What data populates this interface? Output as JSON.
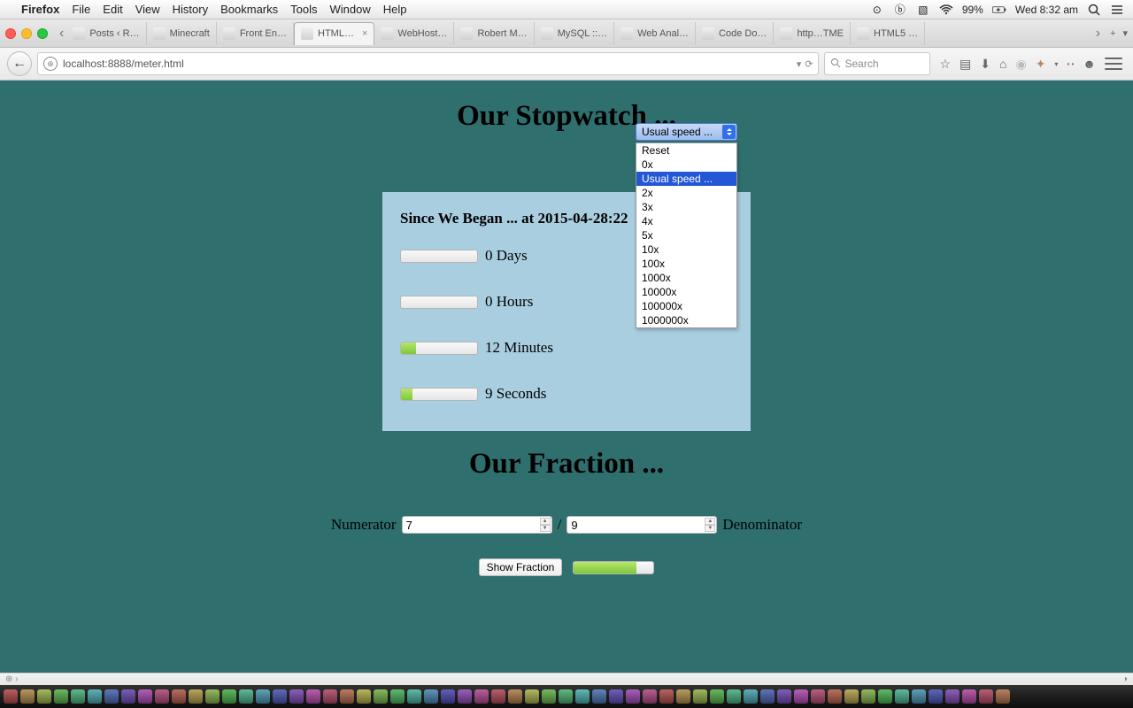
{
  "menubar": {
    "app": "Firefox",
    "items": [
      "File",
      "Edit",
      "View",
      "History",
      "Bookmarks",
      "Tools",
      "Window",
      "Help"
    ],
    "battery": "99%",
    "clock": "Wed 8:32 am"
  },
  "tabstrip": {
    "tabs": [
      "Posts ‹ R…",
      "Minecraft",
      "Front En…",
      "HTML…",
      "WebHost…",
      "Robert M…",
      "MySQL ::…",
      "Web Anal…",
      "Code Do…",
      "http…TME",
      "HTML5 …"
    ],
    "active_index": 3
  },
  "urlbar": {
    "address": "localhost:8888/meter.html",
    "search_placeholder": "Search"
  },
  "stopwatch": {
    "heading": "Our Stopwatch ...",
    "select_label": "Usual speed ...",
    "options": [
      "Reset",
      "0x",
      "Usual speed ...",
      "2x",
      "3x",
      "4x",
      "5x",
      "10x",
      "100x",
      "1000x",
      "10000x",
      "100000x",
      "1000000x"
    ],
    "selected_index": 2,
    "card_title": "Since We Began ... at 2015-04-28:22",
    "rows": [
      {
        "value": "0 Days",
        "pct": 0
      },
      {
        "value": "0 Hours",
        "pct": 0
      },
      {
        "value": "12 Minutes",
        "pct": 20
      },
      {
        "value": "9 Seconds",
        "pct": 15
      }
    ]
  },
  "fraction": {
    "heading": "Our Fraction ...",
    "numerator_label": "Numerator",
    "denominator_label": "Denominator",
    "numerator_value": "7",
    "denominator_value": "9",
    "separator": "/",
    "button": "Show Fraction",
    "meter_pct": 78
  }
}
